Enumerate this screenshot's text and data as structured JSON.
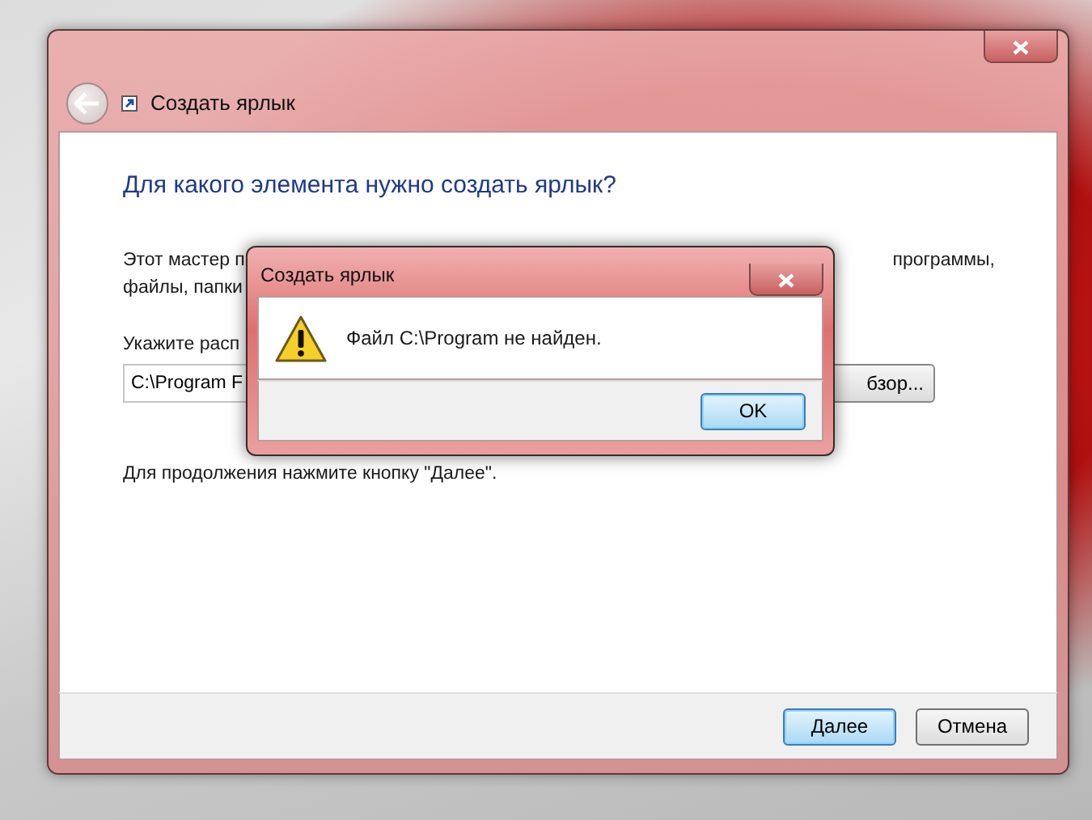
{
  "window": {
    "title": "Создать ярлык"
  },
  "heading": "Для какого элемента нужно создать ярлык?",
  "description": {
    "line_1_start": "Этот мастер п",
    "line_1_end": "программы,",
    "line_2_start": "файлы, папки"
  },
  "location_label": "Укажите расп",
  "location_field": {
    "value": "C:\\Program F"
  },
  "browse_button": "бзор...",
  "hint": "Для продолжения нажмите кнопку \"Далее\".",
  "buttons": [
    {
      "label": "Далее",
      "default": true
    },
    {
      "label": "Отмена",
      "default": false
    }
  ],
  "error_dialog": {
    "title": "Создать ярлык",
    "message": "Файл C:\\Program не найден.",
    "buttons": [
      {
        "label": "OK",
        "default": true
      }
    ]
  }
}
